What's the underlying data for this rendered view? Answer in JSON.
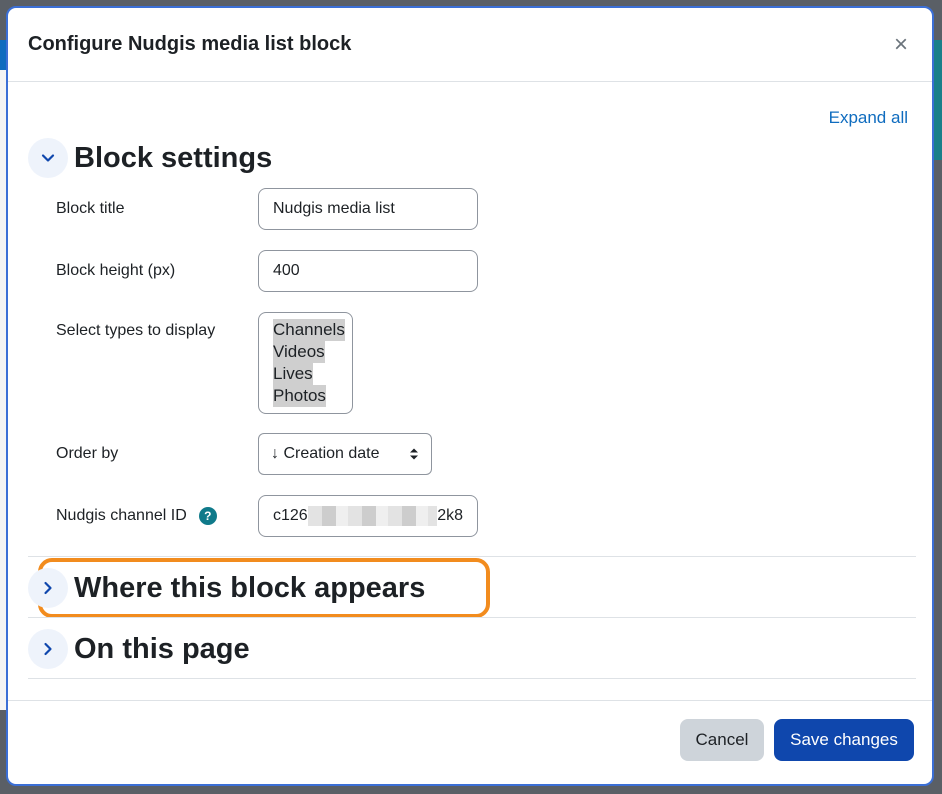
{
  "modal": {
    "title": "Configure Nudgis media list block",
    "close_symbol": "×",
    "expand_all": "Expand all"
  },
  "sections": {
    "block_settings": "Block settings",
    "where_appears": "Where this block appears",
    "on_this_page": "On this page"
  },
  "fields": {
    "block_title": {
      "label": "Block title",
      "value": "Nudgis media list"
    },
    "block_height": {
      "label": "Block height (px)",
      "value": "400"
    },
    "types": {
      "label": "Select types to display",
      "options": [
        "Channels",
        "Videos",
        "Lives",
        "Photos"
      ]
    },
    "order_by": {
      "label": "Order by",
      "value": "↓ Creation date"
    },
    "channel_id": {
      "label": "Nudgis channel ID",
      "help": "?",
      "value_start": "c126",
      "value_end": "2k8"
    }
  },
  "footer": {
    "cancel": "Cancel",
    "save": "Save changes"
  },
  "colors": {
    "primary": "#0f47ad",
    "link": "#0f6cbf",
    "highlight": "#f28c1e",
    "help": "#0f7a8a"
  }
}
